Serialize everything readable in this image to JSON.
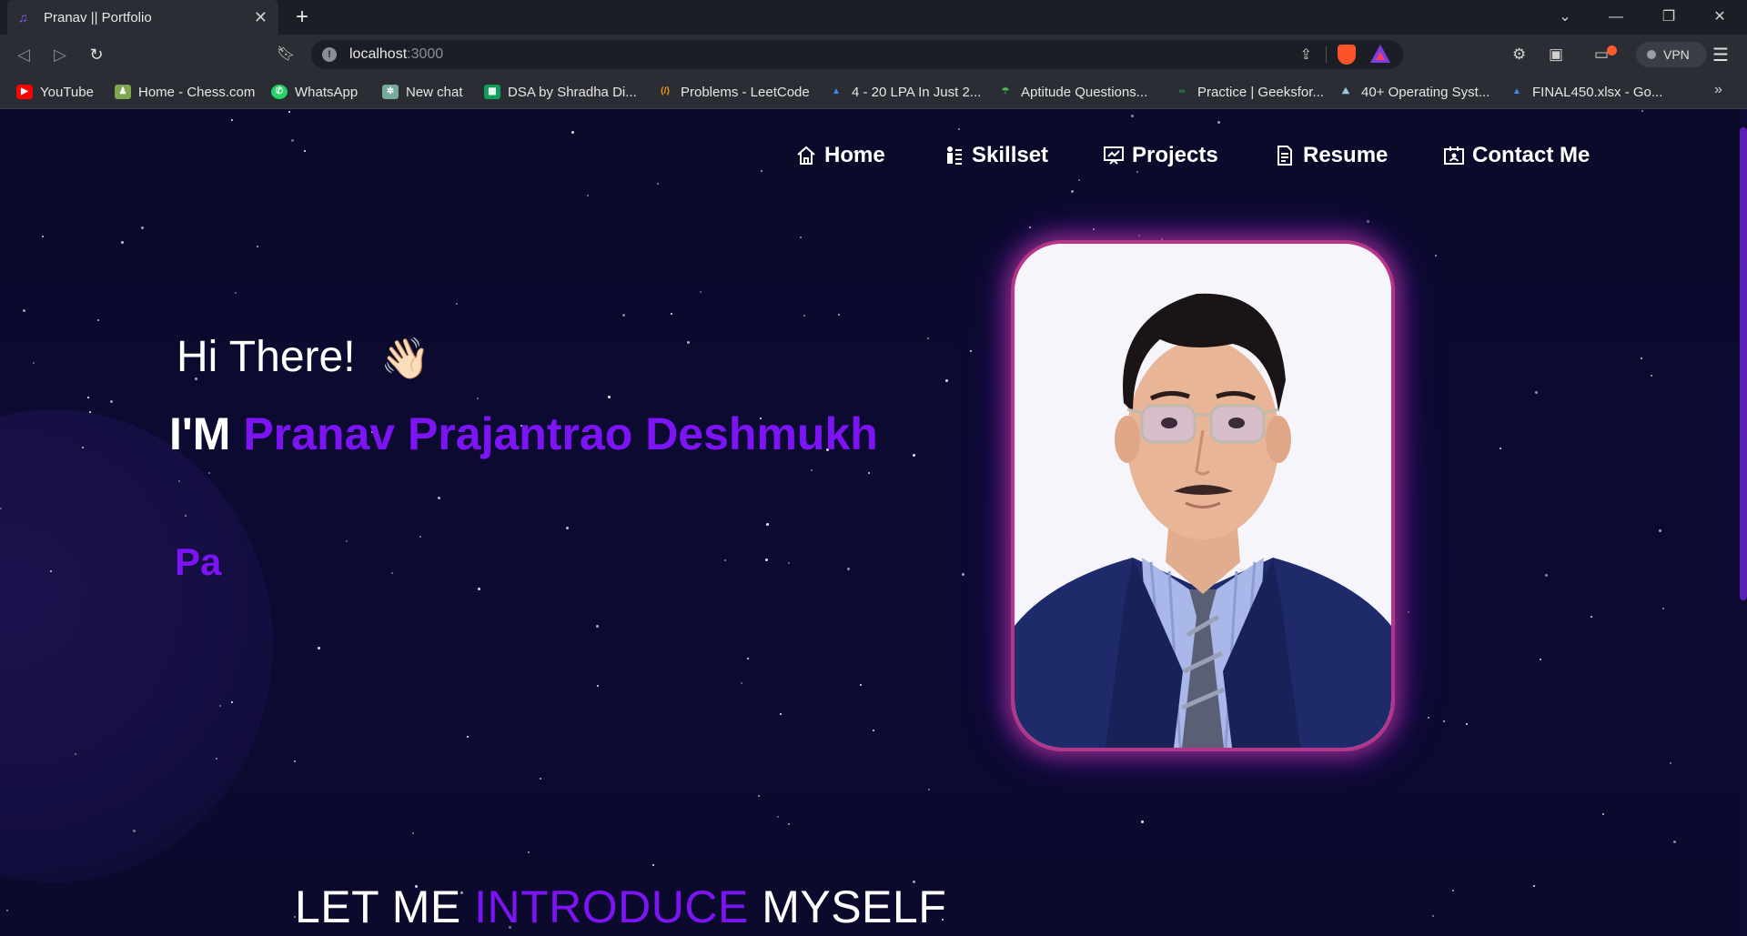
{
  "browser": {
    "tab_title": "Pranav || Portfolio",
    "tab_close": "✕",
    "new_tab": "+",
    "url_host": "localhost",
    "url_port": ":3000",
    "vpn_label": "VPN",
    "window_controls": [
      "⌄",
      "—",
      "❐",
      "✕"
    ],
    "bookmarks": [
      {
        "label": "YouTube",
        "icon": "youtube-icon",
        "color": "#ff0000"
      },
      {
        "label": "Home - Chess.com",
        "icon": "chess-icon",
        "color": "#7fa650"
      },
      {
        "label": "WhatsApp",
        "icon": "whatsapp-icon",
        "color": "#25d366"
      },
      {
        "label": "New chat",
        "icon": "chatgpt-icon",
        "color": "#74aa9c"
      },
      {
        "label": "DSA by Shradha Di...",
        "icon": "sheets-icon",
        "color": "#0f9d58"
      },
      {
        "label": "Problems - LeetCode",
        "icon": "leetcode-icon",
        "color": "#ffa116"
      },
      {
        "label": "4 - 20 LPA In Just 2...",
        "icon": "drive-icon",
        "color": "#4285f4"
      },
      {
        "label": "Aptitude Questions...",
        "icon": "indiabix-icon",
        "color": "#4caf50"
      },
      {
        "label": "Practice | Geeksfor...",
        "icon": "gfg-icon",
        "color": "#2f8d46"
      },
      {
        "label": "40+ Operating Syst...",
        "icon": "interviewbit-icon",
        "color": "#9ec9e2"
      },
      {
        "label": "FINAL450.xlsx - Go...",
        "icon": "drive-icon",
        "color": "#4285f4"
      }
    ]
  },
  "nav": {
    "items": [
      {
        "label": "Home",
        "icon": "home-icon"
      },
      {
        "label": "Skillset",
        "icon": "skillset-icon"
      },
      {
        "label": "Projects",
        "icon": "projects-icon"
      },
      {
        "label": "Resume",
        "icon": "resume-icon"
      },
      {
        "label": "Contact Me",
        "icon": "contact-icon"
      }
    ]
  },
  "hero": {
    "greeting": "Hi There!",
    "wave_emoji": "👋🏻",
    "im_prefix": "I'M ",
    "name": "Pranav Prajantrao Deshmukh",
    "typed_text": "Pa",
    "accent_color": "#7c14f5"
  },
  "intro": {
    "part1": "LET ME ",
    "accent": "INTRODUCE",
    "part2": " MYSELF"
  }
}
